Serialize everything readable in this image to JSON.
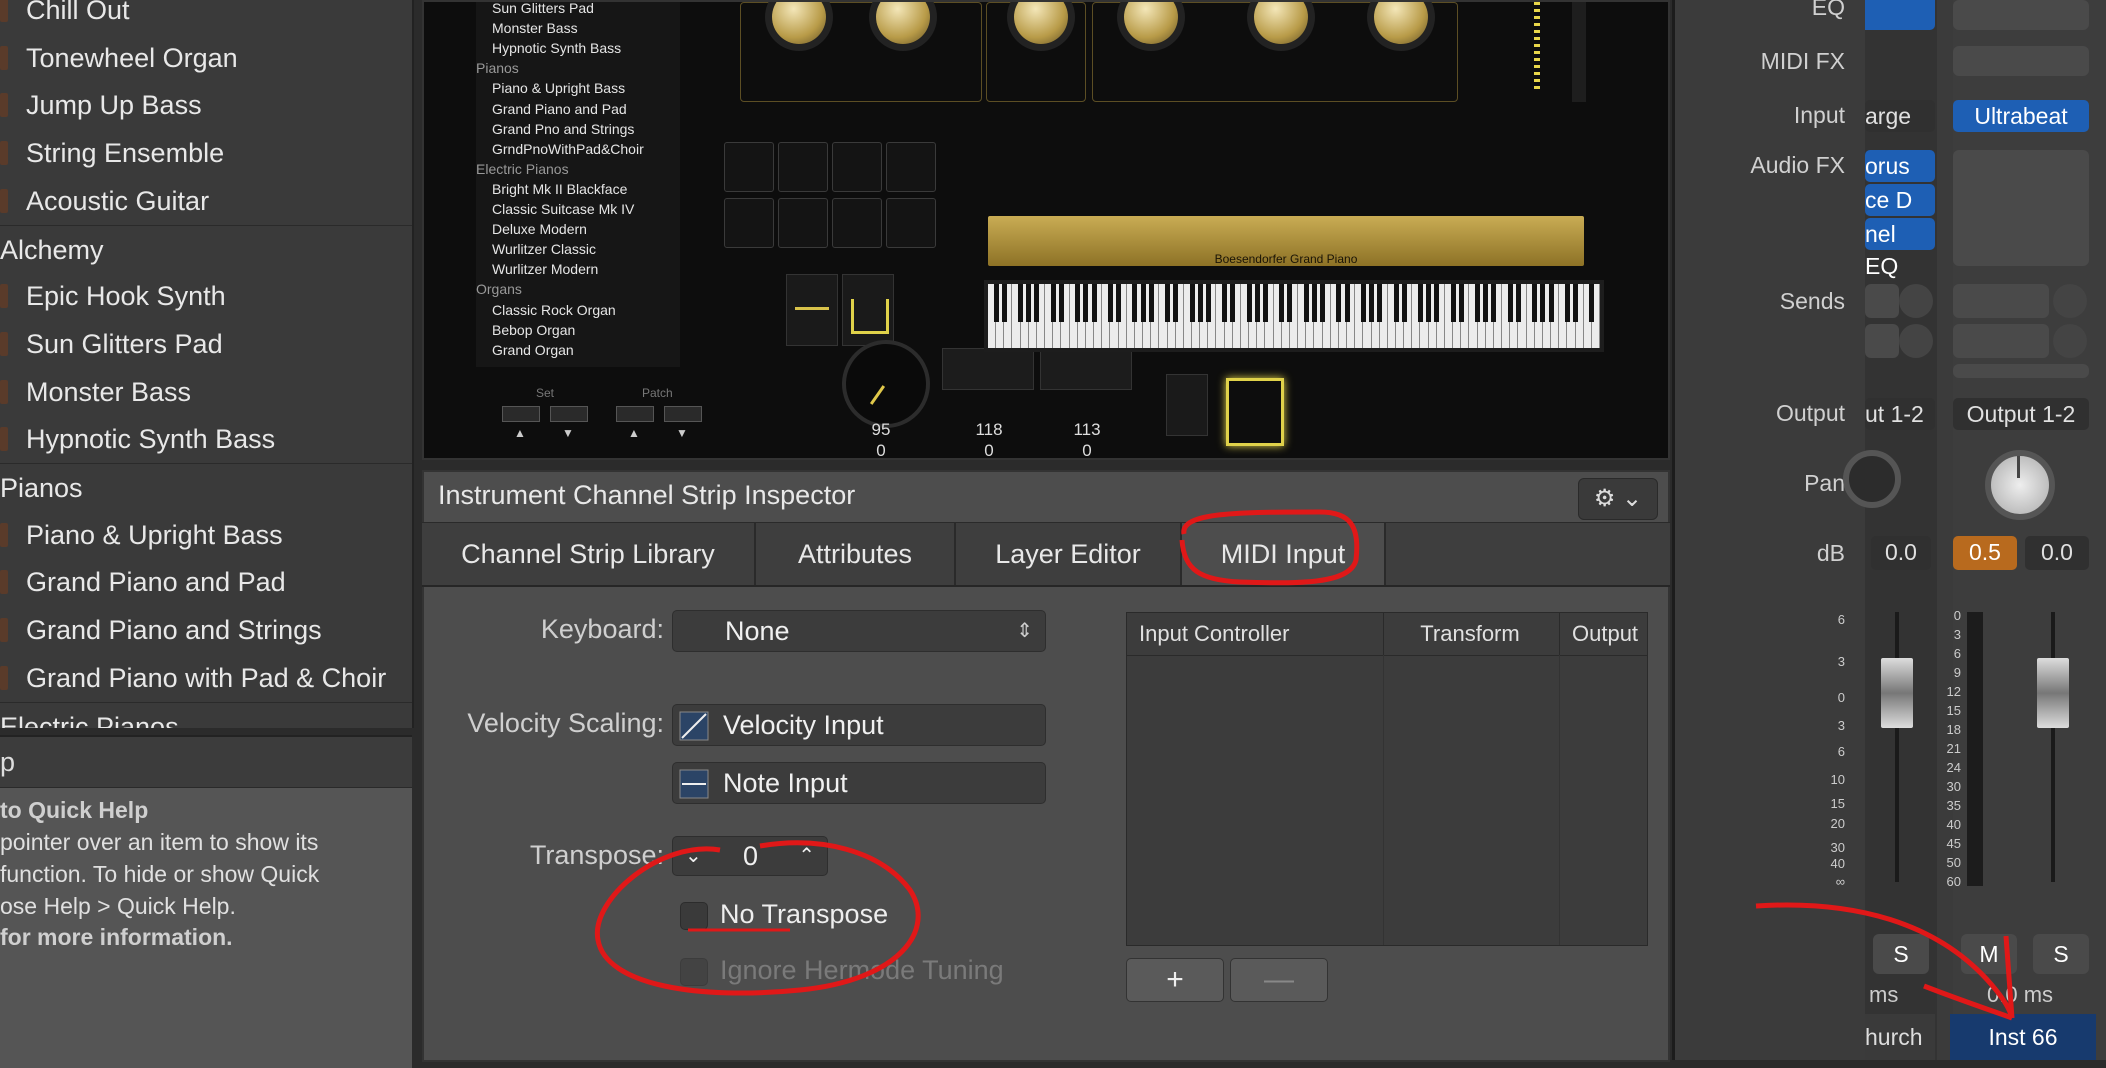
{
  "library": {
    "items": [
      {
        "label": "Chill Out",
        "kind": "item"
      },
      {
        "label": "Tonewheel Organ",
        "kind": "item"
      },
      {
        "label": "Jump Up Bass",
        "kind": "item"
      },
      {
        "label": "String Ensemble",
        "kind": "item"
      },
      {
        "label": "Acoustic Guitar",
        "kind": "item"
      },
      {
        "label": "Alchemy",
        "kind": "cat"
      },
      {
        "label": "Epic Hook Synth",
        "kind": "item"
      },
      {
        "label": "Sun Glitters Pad",
        "kind": "item"
      },
      {
        "label": "Monster Bass",
        "kind": "item"
      },
      {
        "label": "Hypnotic Synth Bass",
        "kind": "item"
      },
      {
        "label": "Pianos",
        "kind": "cat"
      },
      {
        "label": "Piano & Upright Bass",
        "kind": "item"
      },
      {
        "label": "Grand Piano and Pad",
        "kind": "item"
      },
      {
        "label": "Grand Piano and Strings",
        "kind": "item"
      },
      {
        "label": "Grand Piano with Pad & Choir",
        "kind": "item"
      },
      {
        "label": "Electric Pianos",
        "kind": "cat"
      }
    ]
  },
  "quick_help": {
    "header": "p",
    "lines": [
      "to Quick Help",
      "pointer over an item to show its",
      "function. To hide or show Quick",
      "ose Help > Quick Help.",
      "for more information."
    ]
  },
  "plugin": {
    "patches": [
      {
        "label": "Sun Glitters Pad",
        "cat": false
      },
      {
        "label": "Monster Bass",
        "cat": false
      },
      {
        "label": "Hypnotic Synth Bass",
        "cat": false
      },
      {
        "label": "Pianos",
        "cat": true
      },
      {
        "label": "Piano & Upright Bass",
        "cat": false
      },
      {
        "label": "Grand Piano and Pad",
        "cat": false
      },
      {
        "label": "Grand Pno and Strings",
        "cat": false
      },
      {
        "label": "GrndPnoWithPad&Choir",
        "cat": false
      },
      {
        "label": "Electric Pianos",
        "cat": true
      },
      {
        "label": "Bright Mk II Blackface",
        "cat": false
      },
      {
        "label": "Classic Suitcase Mk IV",
        "cat": false
      },
      {
        "label": "Deluxe Modern",
        "cat": false
      },
      {
        "label": "Wurlitzer Classic",
        "cat": false
      },
      {
        "label": "Wurlitzer Modern",
        "cat": false
      },
      {
        "label": "Organs",
        "cat": true
      },
      {
        "label": "Classic Rock Organ",
        "cat": false
      },
      {
        "label": "Bebop Organ",
        "cat": false
      },
      {
        "label": "Grand Organ",
        "cat": false
      }
    ],
    "set_label": "Set",
    "patch_label": "Patch",
    "instrument_name": "Boesendorfer Grand Piano",
    "readouts": [
      {
        "top": "95",
        "bottom": "0"
      },
      {
        "top": "118",
        "bottom": "0"
      },
      {
        "top": "113",
        "bottom": "0"
      }
    ]
  },
  "inspector": {
    "title": "Instrument Channel Strip Inspector",
    "tabs": [
      "Channel Strip Library",
      "Attributes",
      "Layer Editor",
      "MIDI Input"
    ],
    "selected_tab": "MIDI Input",
    "keyboard_label": "Keyboard:",
    "keyboard_value": "None",
    "velocity_label": "Velocity Scaling:",
    "velocity_input": "Velocity Input",
    "note_input": "Note Input",
    "transpose_label": "Transpose:",
    "transpose_value": "0",
    "no_transpose": "No Transpose",
    "ignore_hermode": "Ignore Hermode Tuning",
    "table_headers": [
      "Input Controller",
      "Transform",
      "Output"
    ],
    "add_symbol": "+",
    "remove_symbol": "—"
  },
  "mixer": {
    "labels": {
      "eq": "EQ",
      "midi_fx": "MIDI FX",
      "input": "Input",
      "audio_fx": "Audio FX",
      "sends": "Sends",
      "output": "Output",
      "pan": "Pan",
      "db": "dB"
    },
    "left_strip": {
      "input": "arge",
      "audio_fx": [
        "orus",
        "ce D",
        "nel EQ"
      ],
      "output": "ut 1-2",
      "db": "0.0",
      "solo": "S",
      "latency": "ms",
      "name": "hurch"
    },
    "right_strip": {
      "input": "Ultrabeat",
      "output": "Output 1-2",
      "db_peak": "0.5",
      "db": "0.0",
      "mute": "M",
      "solo": "S",
      "latency": "0.0 ms",
      "name": "Inst 66"
    },
    "scale_left": [
      "6",
      "3",
      "0",
      "3",
      "6",
      "10",
      "15",
      "20",
      "30",
      "40",
      "∞"
    ],
    "scale_right": [
      "0",
      "3",
      "6",
      "9",
      "12",
      "15",
      "18",
      "21",
      "24",
      "30",
      "35",
      "40",
      "45",
      "50",
      "60"
    ]
  },
  "colors": {
    "accent_blue": "#1e5fb4",
    "gold": "#c9ac54",
    "annotation_red": "#e01818",
    "peak_orange": "#b86a1e"
  }
}
